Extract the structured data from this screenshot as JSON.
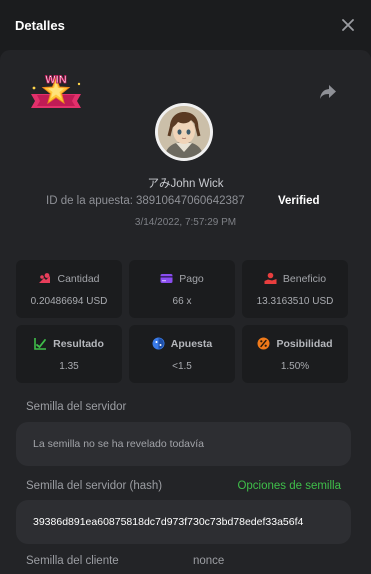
{
  "header": {
    "title": "Detalles"
  },
  "win_badge": {
    "text": "WIN"
  },
  "user": {
    "name": "アみJohn Wick"
  },
  "bet": {
    "id_label": "ID de la apuesta:",
    "id_value": "38910647060642387",
    "verified": "Verified",
    "datetime": "3/14/2022, 7:57:29 PM"
  },
  "stats": [
    {
      "label": "Cantidad",
      "value": "0.20486694 USD",
      "icon": "coins-icon",
      "color": "#e83e5b"
    },
    {
      "label": "Pago",
      "value": "66 x",
      "icon": "card-icon",
      "color": "#8a4df0"
    },
    {
      "label": "Beneficio",
      "value": "13.3163510 USD",
      "icon": "hand-coins-icon",
      "color": "#e83e3e"
    },
    {
      "label": "Resultado",
      "value": "1.35",
      "icon": "chart-check-icon",
      "color": "#3fbf4a"
    },
    {
      "label": "Apuesta",
      "value": "<1.5",
      "icon": "dice-icon",
      "color": "#3a7be8"
    },
    {
      "label": "Posibilidad",
      "value": "1.50%",
      "icon": "percent-icon",
      "color": "#f07a1a"
    }
  ],
  "server_seed": {
    "label": "Semilla del servidor",
    "value": "La semilla no se ha revelado todavía"
  },
  "server_seed_hash": {
    "label": "Semilla del servidor (hash)",
    "link": "Opciones de semilla",
    "value": "39386d891ea60875818dc7d973f730c73bd78edef33a56f4"
  },
  "client_seed": {
    "label": "Semilla del cliente",
    "nonce_label": "nonce"
  }
}
